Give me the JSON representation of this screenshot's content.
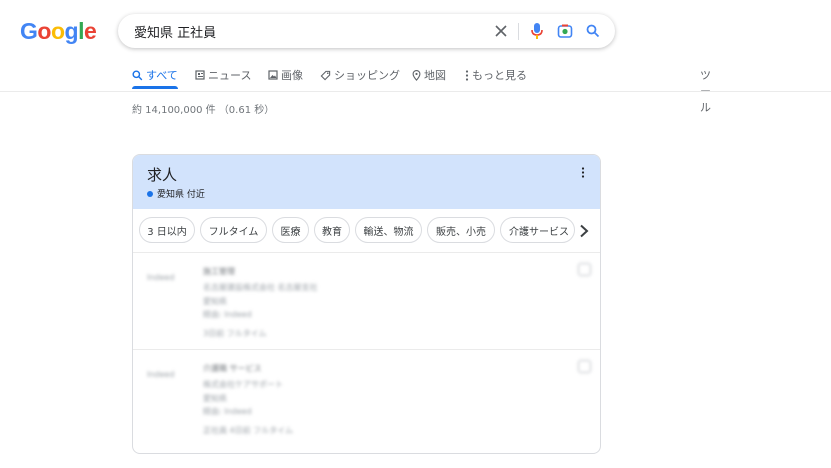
{
  "logo": {
    "letters": [
      "G",
      "o",
      "o",
      "g",
      "l",
      "e"
    ],
    "colors": [
      "#4285f4",
      "#ea4335",
      "#fbbc05",
      "#4285f4",
      "#34a853",
      "#ea4335"
    ]
  },
  "search": {
    "query": "愛知県 正社員",
    "icons": [
      "close-icon",
      "microphone-icon",
      "lens-icon",
      "search-icon"
    ]
  },
  "tabs": [
    {
      "label": "すべて",
      "icon": "search-icon"
    },
    {
      "label": "ニュース",
      "icon": "news-icon"
    },
    {
      "label": "画像",
      "icon": "image-icon"
    },
    {
      "label": "ショッピング",
      "icon": "tag-icon"
    },
    {
      "label": "地図",
      "icon": "pin-icon"
    },
    {
      "label": "もっと見る",
      "icon": "more-vert-icon"
    }
  ],
  "tools_label": "ツール",
  "result_stats": "約 14,100,000 件 （0.61 秒）",
  "jobs": {
    "title": "求人",
    "location": "愛知県 付近",
    "chips": [
      "3 日以内",
      "フルタイム",
      "医療",
      "教育",
      "輸送、物流",
      "販売、小売",
      "介護サービス"
    ],
    "listings": [
      {
        "logo": "Indeed",
        "lines": [
          "施工管理",
          "名古屋建設株式会社 名古屋支社",
          "愛知県",
          "経由: Indeed",
          "3日前 フルタイム"
        ]
      },
      {
        "logo": "Indeed",
        "lines": [
          "介護職 サービス",
          "株式会社ケアサポート",
          "愛知県",
          "経由: Indeed",
          "正社員 4日前 フルタイム"
        ]
      }
    ]
  },
  "colors": {
    "accent": "#1a73e8",
    "jobs_header_bg": "#d2e3fc"
  }
}
